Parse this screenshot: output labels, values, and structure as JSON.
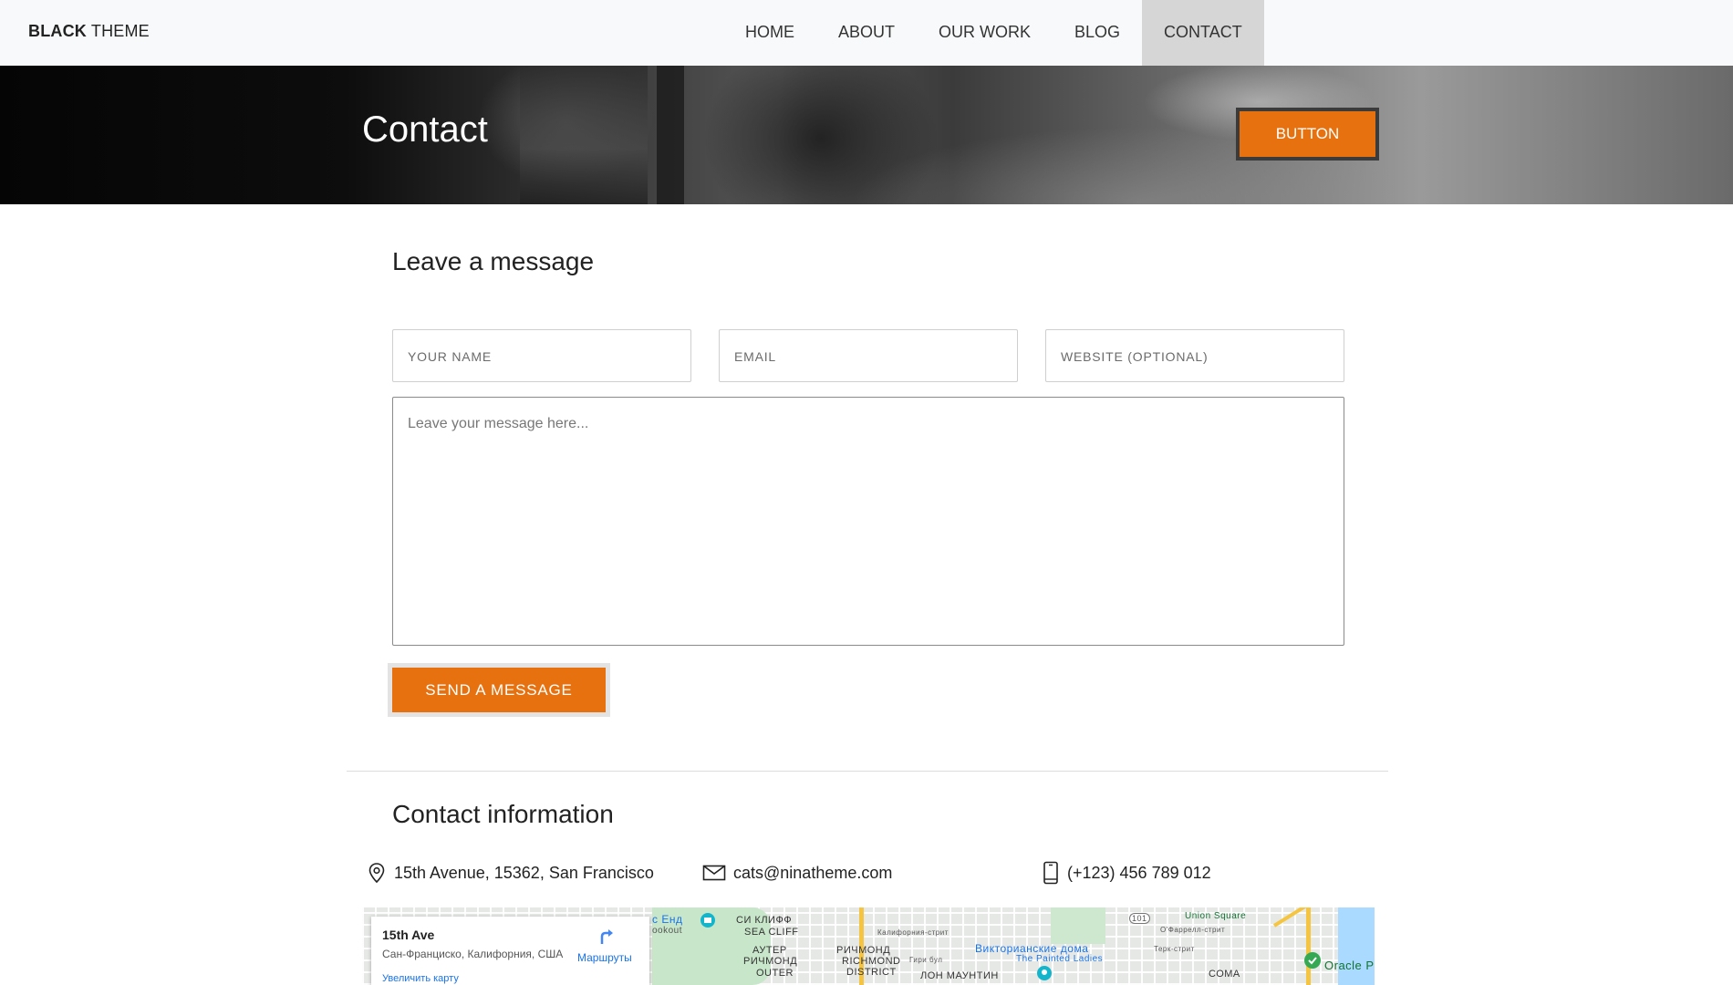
{
  "navbar": {
    "brand_bold": "BLACK",
    "brand_rest": " THEME",
    "items": [
      {
        "label": "HOME"
      },
      {
        "label": "ABOUT"
      },
      {
        "label": "OUR WORK"
      },
      {
        "label": "BLOG"
      },
      {
        "label": "CONTACT",
        "active": true
      }
    ]
  },
  "hero": {
    "title": "Contact",
    "button_label": "BUTTON"
  },
  "form": {
    "heading": "Leave a message",
    "name_placeholder": "YOUR NAME",
    "email_placeholder": "EMAIL",
    "website_placeholder": "WEBSITE (OPTIONAL)",
    "message_placeholder": "Leave your message here...",
    "submit_label": "SEND A MESSAGE"
  },
  "contact_info": {
    "heading": "Contact information",
    "address": "15th Avenue, 15362, San Francisco",
    "email": "cats@ninatheme.com",
    "phone": "(+123) 456 789 012",
    "icons": [
      "location-pin-icon",
      "envelope-icon",
      "phone-icon"
    ]
  },
  "map": {
    "place_title": "15th Ave",
    "place_address": "Сан-Франциско, Калифорния, США",
    "enlarge_link": "Увеличить карту",
    "directions_label": "Маршруты",
    "labels": {
      "sea_cliff_ru": "СИ КЛИФФ",
      "sea_cliff": "SEA CLIFF",
      "lookout": "ookout",
      "outer_richmond_ru_1": "АУТЕР",
      "outer_richmond_ru_2": "РИЧМОНД",
      "outer": "OUTER",
      "richmond_ru": "РИЧМОНД",
      "richmond_district_1": "RICHMOND",
      "richmond_district_2": "DISTRICT",
      "victorian_houses": "Викторианские дома",
      "painted_ladies": "The Painted Ladies",
      "lone_mountain_ru": "ЛОН МАУНТИН",
      "union_square": "Union Square",
      "soma_ru": "СОМА",
      "oracle_park": "Oracle Pa",
      "highway": "101",
      "california_st": "Калифорния-стрит",
      "geary_blvd": "Гири бул",
      "ofarrell_st": "О'Фаррелл-стрит",
      "turk_st": "Терк-стрит",
      "ends": "с Енд"
    }
  },
  "colors": {
    "accent": "#e8710f",
    "nav_bg": "#f8f9fa",
    "nav_active_bg": "#d6d6d6"
  }
}
